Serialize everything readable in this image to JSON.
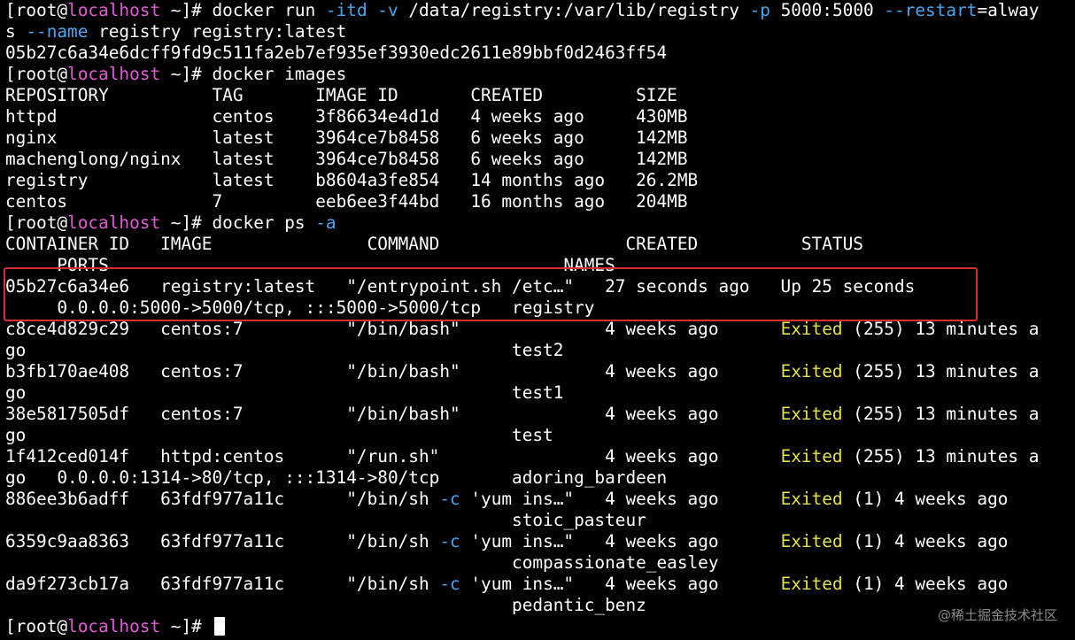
{
  "colors": {
    "background": "#000000",
    "text": "#ffffff",
    "hostname": "#e25bd7",
    "flag": "#46a6f1",
    "exited": "#e6e04b",
    "highlight_box": "#d6312c"
  },
  "prompt": {
    "open": "[root@",
    "host": "localhost",
    "close": " ~]# "
  },
  "lines": [
    {
      "segs": [
        {
          "t": "docker run "
        },
        {
          "t": "-itd -v",
          "c": "flag"
        },
        {
          "t": " /data/registry:/var/lib/registry "
        },
        {
          "t": "-p",
          "c": "flag"
        },
        {
          "t": " 5000:5000 "
        },
        {
          "t": "--restart",
          "c": "flag"
        },
        {
          "t": "=alway"
        }
      ],
      "prompt": true
    },
    {
      "segs": [
        {
          "t": "s "
        },
        {
          "t": "--name",
          "c": "flag"
        },
        {
          "t": " registry registry:latest"
        }
      ]
    },
    {
      "segs": [
        {
          "t": "05b27c6a34e6dcff9fd9c511fa2eb7ef935ef3930edc2611e89bbf0d2463ff54"
        }
      ]
    },
    {
      "segs": [
        {
          "t": "docker images"
        }
      ],
      "prompt": true
    },
    {
      "segs": [
        {
          "t": "REPOSITORY          TAG       IMAGE ID       CREATED         SIZE"
        }
      ]
    },
    {
      "segs": [
        {
          "t": "httpd               centos    3f86634e4d1d   4 weeks ago     430MB"
        }
      ]
    },
    {
      "segs": [
        {
          "t": "nginx               latest    3964ce7b8458   6 weeks ago     142MB"
        }
      ]
    },
    {
      "segs": [
        {
          "t": "machenglong/nginx   latest    3964ce7b8458   6 weeks ago     142MB"
        }
      ]
    },
    {
      "segs": [
        {
          "t": "registry            latest    b8604a3fe854   14 months ago   26.2MB"
        }
      ]
    },
    {
      "segs": [
        {
          "t": "centos              7         eeb6ee3f44bd   16 months ago   204MB"
        }
      ]
    },
    {
      "segs": [
        {
          "t": "docker ps "
        },
        {
          "t": "-a",
          "c": "flag"
        }
      ],
      "prompt": true
    },
    {
      "segs": [
        {
          "t": "CONTAINER ID   IMAGE               COMMAND                  CREATED          STATUS"
        }
      ]
    },
    {
      "segs": [
        {
          "t": "     PORTS                                            NAMES"
        }
      ]
    },
    {
      "segs": [
        {
          "t": "05b27c6a34e6   registry:latest   \"/entrypoint.sh /etc…\"   27 seconds ago   Up 25 seconds"
        }
      ]
    },
    {
      "segs": [
        {
          "t": "     0.0.0.0:5000->5000/tcp, :::5000->5000/tcp   registry"
        }
      ]
    },
    {
      "segs": [
        {
          "t": "c8ce4d829c29   centos:7          \"/bin/bash\"              4 weeks ago      "
        },
        {
          "t": "Exited",
          "c": "exited"
        },
        {
          "t": " (255) 13 minutes a"
        }
      ]
    },
    {
      "segs": [
        {
          "t": "go                                               test2"
        }
      ]
    },
    {
      "segs": [
        {
          "t": "b3fb170ae408   centos:7          \"/bin/bash\"              4 weeks ago      "
        },
        {
          "t": "Exited",
          "c": "exited"
        },
        {
          "t": " (255) 13 minutes a"
        }
      ]
    },
    {
      "segs": [
        {
          "t": "go                                               test1"
        }
      ]
    },
    {
      "segs": [
        {
          "t": "38e5817505df   centos:7          \"/bin/bash\"              4 weeks ago      "
        },
        {
          "t": "Exited",
          "c": "exited"
        },
        {
          "t": " (255) 13 minutes a"
        }
      ]
    },
    {
      "segs": [
        {
          "t": "go                                               test"
        }
      ]
    },
    {
      "segs": [
        {
          "t": "1f412ced014f   httpd:centos      \"/run.sh\"                4 weeks ago      "
        },
        {
          "t": "Exited",
          "c": "exited"
        },
        {
          "t": " (255) 13 minutes a"
        }
      ]
    },
    {
      "segs": [
        {
          "t": "go   0.0.0.0:1314->80/tcp, :::1314->80/tcp       adoring_bardeen"
        }
      ]
    },
    {
      "segs": [
        {
          "t": "886ee3b6adff   63fdf977a11c      \"/bin/sh "
        },
        {
          "t": "-c",
          "c": "flag"
        },
        {
          "t": " 'yum ins…\"   4 weeks ago      "
        },
        {
          "t": "Exited",
          "c": "exited"
        },
        {
          "t": " (1) 4 weeks ago"
        }
      ]
    },
    {
      "segs": [
        {
          "t": "                                                 stoic_pasteur"
        }
      ]
    },
    {
      "segs": [
        {
          "t": "6359c9aa8363   63fdf977a11c      \"/bin/sh "
        },
        {
          "t": "-c",
          "c": "flag"
        },
        {
          "t": " 'yum ins…\"   4 weeks ago      "
        },
        {
          "t": "Exited",
          "c": "exited"
        },
        {
          "t": " (1) 4 weeks ago"
        }
      ]
    },
    {
      "segs": [
        {
          "t": "                                                 compassionate_easley"
        }
      ]
    },
    {
      "segs": [
        {
          "t": "da9f273cb17a   63fdf977a11c      \"/bin/sh "
        },
        {
          "t": "-c",
          "c": "flag"
        },
        {
          "t": " 'yum ins…\"   4 weeks ago      "
        },
        {
          "t": "Exited",
          "c": "exited"
        },
        {
          "t": " (1) 4 weeks ago"
        }
      ]
    },
    {
      "segs": [
        {
          "t": "                                                 pedantic_benz"
        }
      ]
    },
    {
      "segs": [],
      "prompt": true,
      "cursor": true
    }
  ],
  "watermark": "@稀土掘金技术社区"
}
